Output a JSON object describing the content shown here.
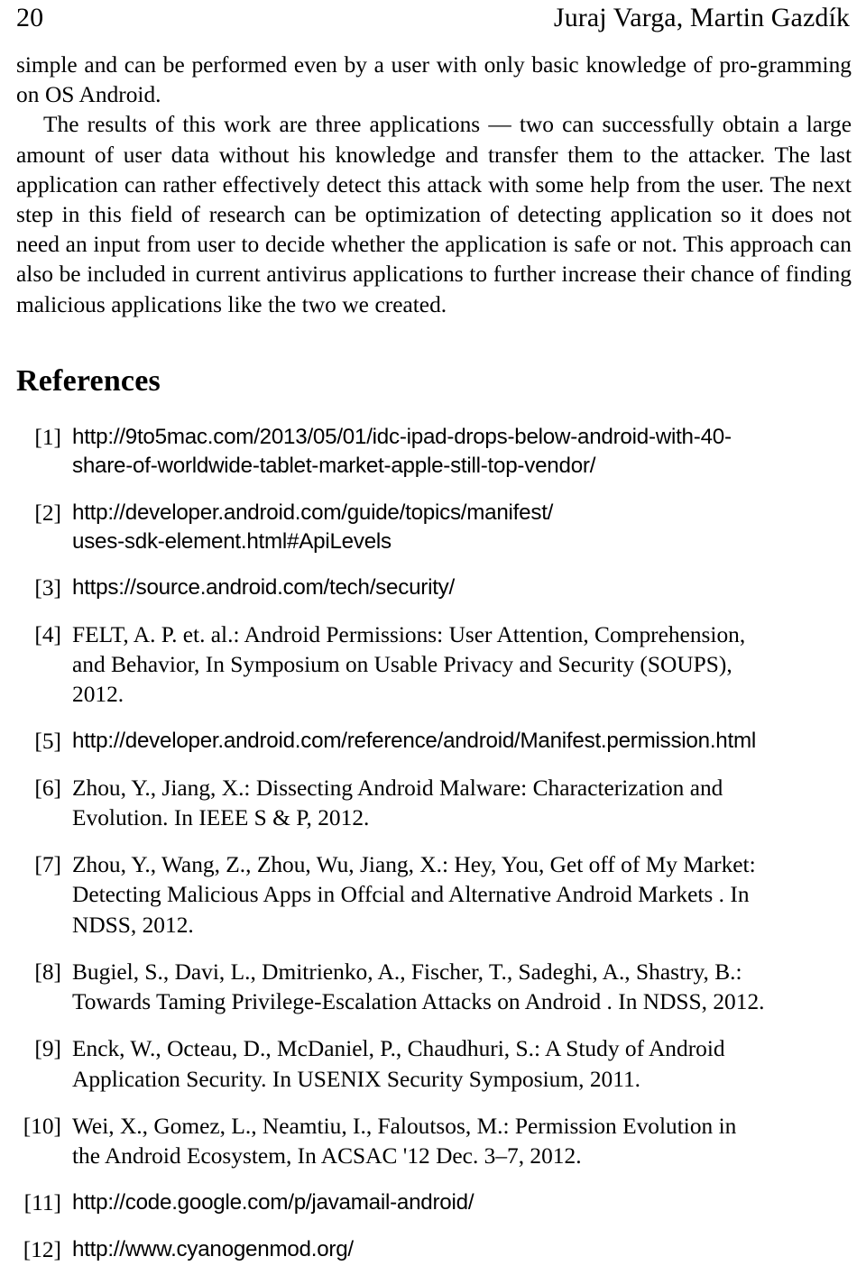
{
  "header": {
    "folio": "20",
    "authors": "Juraj Varga, Martin Gazdík"
  },
  "body": {
    "paragraph_continued": "simple and can be performed even by a user with only basic knowledge of pro-gramming on OS Android.",
    "paragraph_results": "The results of this work are three applications — two can successfully obtain a large amount of user data without his knowledge and transfer them to the attacker. The last application can rather effectively detect this attack with some help from the user. The next step in this field of research can be optimization of detecting application so it does not need an input from user to decide whether the application is safe or not. This approach can also be included in current antivirus applications to further increase their chance of finding malicious applications like the two we created."
  },
  "references": {
    "heading": "References",
    "items": [
      {
        "label": "[1]",
        "style": "url",
        "lines": [
          "http://9to5mac.com/2013/05/01/idc-ipad-drops-below-android-with-40-",
          "share-of-worldwide-tablet-market-apple-still-top-vendor/"
        ],
        "text": "http://9to5mac.com/2013/05/01/idc-ipad-drops-below-android-with-40-share-of-worldwide-tablet-market-apple-still-top-vendor/"
      },
      {
        "label": "[2]",
        "style": "url",
        "lines": [
          "http://developer.android.com/guide/topics/manifest/",
          "uses-sdk-element.html#ApiLevels"
        ],
        "text": "http://developer.android.com/guide/topics/manifest/uses-sdk-element.html#ApiLevels"
      },
      {
        "label": "[3]",
        "style": "url",
        "lines": [
          "https://source.android.com/tech/security/"
        ],
        "text": "https://source.android.com/tech/security/"
      },
      {
        "label": "[4]",
        "style": "serif",
        "lines": [
          "FELT, A. P. et. al.: Android Permissions: User Attention, Comprehension,",
          "and Behavior, In Symposium on Usable Privacy and Security (SOUPS),",
          "2012."
        ],
        "text": "FELT, A. P. et. al.: Android Permissions: User Attention, Comprehension, and Behavior, In Symposium on Usable Privacy and Security (SOUPS), 2012."
      },
      {
        "label": "[5]",
        "style": "url",
        "lines": [
          "http://developer.android.com/reference/android/Manifest.permission.html"
        ],
        "text": "http://developer.android.com/reference/android/Manifest.permission.html"
      },
      {
        "label": "[6]",
        "style": "serif",
        "lines": [
          "Zhou, Y., Jiang, X.: Dissecting Android Malware: Characterization and",
          "Evolution. In IEEE S & P, 2012."
        ],
        "text": "Zhou, Y., Jiang, X.: Dissecting Android Malware: Characterization and Evolution. In IEEE S & P, 2012."
      },
      {
        "label": "[7]",
        "style": "serif",
        "lines": [
          "Zhou, Y., Wang, Z., Zhou, Wu, Jiang, X.: Hey, You, Get off of My Market:",
          "Detecting Malicious Apps in Offcial and Alternative Android Markets . In",
          "NDSS, 2012."
        ],
        "text": "Zhou, Y., Wang, Z., Zhou, Wu, Jiang, X.: Hey, You, Get off of My Market: Detecting Malicious Apps in Offcial and Alternative Android Markets . In NDSS, 2012."
      },
      {
        "label": "[8]",
        "style": "serif",
        "lines": [
          "Bugiel, S., Davi, L., Dmitrienko, A., Fischer, T., Sadeghi, A., Shastry, B.:",
          "Towards Taming Privilege-Escalation Attacks on Android . In NDSS, 2012."
        ],
        "text": "Bugiel, S., Davi, L., Dmitrienko, A., Fischer, T., Sadeghi, A., Shastry, B.: Towards Taming Privilege-Escalation Attacks on Android . In NDSS, 2012."
      },
      {
        "label": "[9]",
        "style": "serif",
        "lines": [
          "Enck, W., Octeau, D., McDaniel, P., Chaudhuri, S.: A Study of Android",
          "Application Security. In USENIX Security Symposium, 2011."
        ],
        "text": "Enck, W., Octeau, D., McDaniel, P., Chaudhuri, S.: A Study of Android Application Security. In USENIX Security Symposium, 2011."
      },
      {
        "label": "[10]",
        "style": "serif",
        "lines": [
          "Wei, X., Gomez, L., Neamtiu, I., Faloutsos, M.: Permission Evolution in",
          "the Android Ecosystem, In ACSAC '12 Dec. 3–7, 2012."
        ],
        "text": "Wei, X., Gomez, L., Neamtiu, I., Faloutsos, M.: Permission Evolution in the Android Ecosystem, In ACSAC '12 Dec. 3–7, 2012."
      },
      {
        "label": "[11]",
        "style": "url",
        "lines": [
          "http://code.google.com/p/javamail-android/"
        ],
        "text": "http://code.google.com/p/javamail-android/"
      },
      {
        "label": "[12]",
        "style": "url",
        "lines": [
          "http://www.cyanogenmod.org/"
        ],
        "text": "http://www.cyanogenmod.org/"
      }
    ]
  }
}
